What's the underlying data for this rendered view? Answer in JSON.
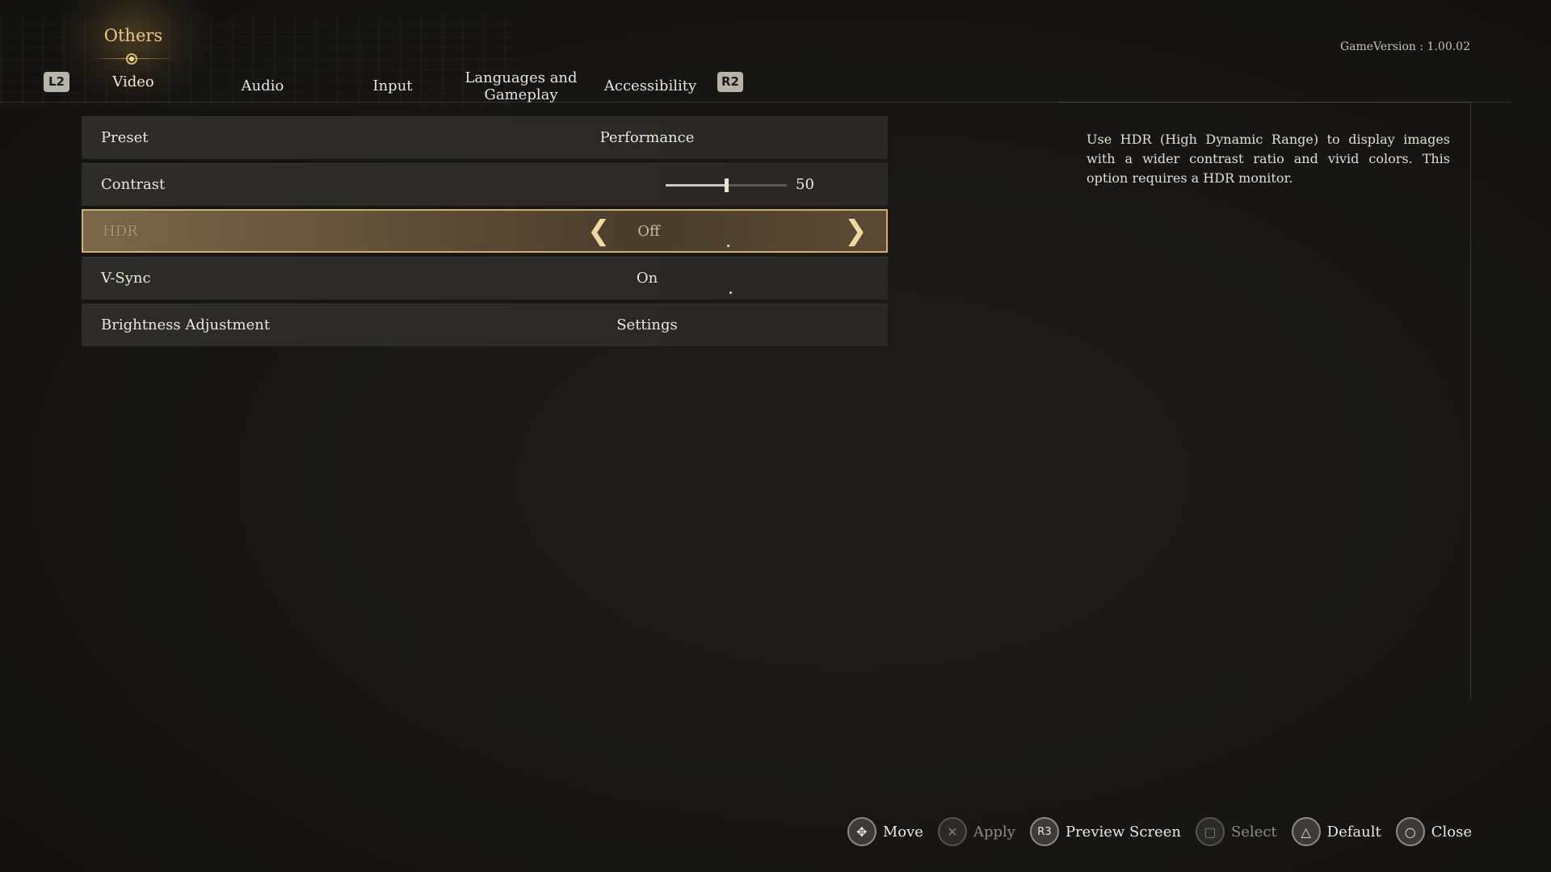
{
  "header": {
    "category": "Others",
    "left_shoulder": "L2",
    "right_shoulder": "R2",
    "tabs": [
      {
        "label": "Video",
        "active": true
      },
      {
        "label": "Audio",
        "active": false
      },
      {
        "label": "Input",
        "active": false
      },
      {
        "label_line1": "Languages  and",
        "label_line2": "Gameplay",
        "active": false
      },
      {
        "label": "Accessibility",
        "active": false
      }
    ],
    "version": "GameVersion : 1.00.02"
  },
  "settings": [
    {
      "label": "Preset",
      "value": "Performance"
    },
    {
      "label": "Contrast",
      "value": "50",
      "slider_fraction": 0.5
    },
    {
      "label": "HDR",
      "value": "Off",
      "selected": true
    },
    {
      "label": "V-Sync",
      "value": "On"
    },
    {
      "label": "Brightness  Adjustment",
      "value": "Settings"
    }
  ],
  "description": "Use HDR (High Dynamic Range) to display images with a wider contrast ratio and vivid colors. This option requires a HDR monitor.",
  "footer": {
    "prompts": [
      {
        "icon": "dpad-icon",
        "glyph": "✥",
        "label": "Move",
        "enabled": true
      },
      {
        "icon": "cross-button-icon",
        "glyph": "✕",
        "label": "Apply",
        "enabled": false
      },
      {
        "icon": "r3-button-icon",
        "glyph": "R3",
        "label": "Preview  Screen",
        "enabled": true
      },
      {
        "icon": "square-button-icon",
        "glyph": "▢",
        "label": "Select",
        "enabled": false
      },
      {
        "icon": "triangle-button-icon",
        "glyph": "△",
        "label": "Default",
        "enabled": true
      },
      {
        "icon": "circle-button-icon",
        "glyph": "○",
        "label": "Close",
        "enabled": true
      }
    ]
  },
  "colors": {
    "accent_gold": "#cdb06f",
    "selected_row": "#6e5c42",
    "row_bg": "#2d2b28",
    "background": "#171614"
  }
}
